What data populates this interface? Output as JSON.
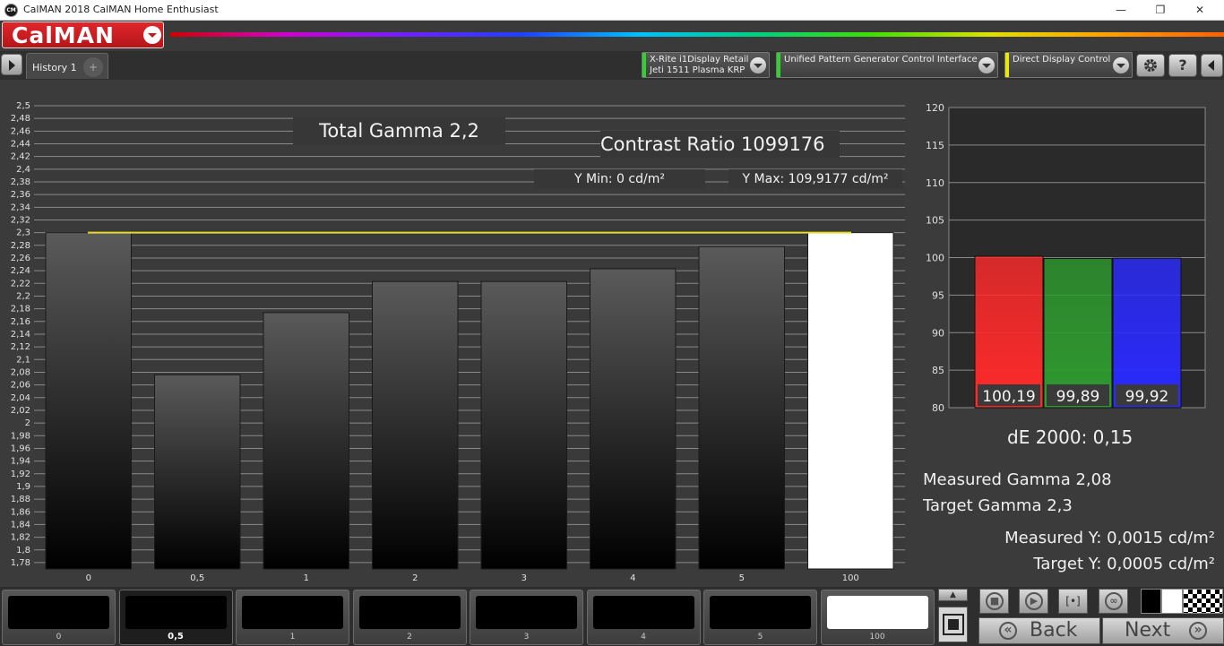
{
  "window": {
    "title": "CalMAN 2018 CalMAN Home Enthusiast",
    "app_icon_text": "CM",
    "minimize": "—",
    "maximize": "❐",
    "close": "✕"
  },
  "header": {
    "logo": "CalMAN"
  },
  "tabs": {
    "history_label": "History 1",
    "add_label": "+"
  },
  "devices": [
    {
      "line1": "X-Rite i1Display Retail",
      "line2": "Jeti 1511 Plasma KRP",
      "color": "#2fd12f"
    },
    {
      "line1": "Unified Pattern Generator Control Interface",
      "line2": "",
      "color": "#2fd12f"
    },
    {
      "line1": "Direct Display Control",
      "line2": "",
      "color": "#e8e800"
    }
  ],
  "toolbar": {
    "settings_icon": "gear-icon",
    "help_label": "?",
    "collapse_icon": "chevron-left-icon"
  },
  "gamma": {
    "total_gamma": "Total Gamma 2,2",
    "contrast_ratio": "Contrast Ratio 1099176",
    "y_min": "Y Min: 0 cd/m²",
    "y_max": "Y Max: 109,9177 cd/m²"
  },
  "chart_data": [
    {
      "type": "bar",
      "categories": [
        "0",
        "0,5",
        "1",
        "2",
        "3",
        "4",
        "5",
        "100"
      ],
      "values": [
        2.3,
        2.076,
        2.174,
        2.223,
        2.223,
        2.243,
        2.278,
        2.3
      ],
      "bar_styles": [
        "dark",
        "dark",
        "dark",
        "dark",
        "dark",
        "dark",
        "dark",
        "white"
      ],
      "target": 2.3,
      "target_color": "#e6dc28",
      "ylim": [
        1.77,
        2.5
      ],
      "yticks": [
        "1,78",
        "1,8",
        "1,82",
        "1,84",
        "1,86",
        "1,88",
        "1,9",
        "1,92",
        "1,94",
        "1,96",
        "1,98",
        "2",
        "2,02",
        "2,04",
        "2,06",
        "2,08",
        "2,1",
        "2,12",
        "2,14",
        "2,16",
        "2,18",
        "2,2",
        "2,22",
        "2,24",
        "2,26",
        "2,28",
        "2,3",
        "2,32",
        "2,34",
        "2,36",
        "2,38",
        "2,4",
        "2,42",
        "2,44",
        "2,46",
        "2,48",
        "2,5"
      ],
      "grid": true
    },
    {
      "type": "bar",
      "categories": [
        "R",
        "G",
        "B"
      ],
      "values": [
        100.19,
        99.89,
        99.92
      ],
      "value_labels": [
        "100,19",
        "99,89",
        "99,92"
      ],
      "colors": [
        "#ff2a2a",
        "#2e9a2e",
        "#2a2aff"
      ],
      "ylim": [
        80,
        120
      ],
      "yticks": [
        "80",
        "85",
        "90",
        "95",
        "100",
        "105",
        "110",
        "115",
        "120"
      ],
      "grid": true
    }
  ],
  "stats": {
    "de2000": "dE 2000: 0,15",
    "measured_gamma": "Measured Gamma 2,08",
    "target_gamma": "Target Gamma 2,3",
    "measured_y": "Measured Y: 0,0015 cd/m²",
    "target_y": "Target Y: 0,0005 cd/m²"
  },
  "swatches": [
    {
      "label": "0",
      "color": "#000000",
      "selected": false
    },
    {
      "label": "0,5",
      "color": "#000000",
      "selected": true
    },
    {
      "label": "1",
      "color": "#000000",
      "selected": false
    },
    {
      "label": "2",
      "color": "#000000",
      "selected": false
    },
    {
      "label": "3",
      "color": "#000000",
      "selected": false
    },
    {
      "label": "4",
      "color": "#000000",
      "selected": false
    },
    {
      "label": "5",
      "color": "#000000",
      "selected": false
    },
    {
      "label": "100",
      "color": "#ffffff",
      "selected": false
    }
  ],
  "controls": {
    "stop_icon": "stop-icon",
    "play_icon": "play-icon",
    "frame_label": "[•]",
    "loop_label": "∞",
    "back_label": "Back",
    "next_label": "Next",
    "back_glyph": "«",
    "next_glyph": "»"
  }
}
